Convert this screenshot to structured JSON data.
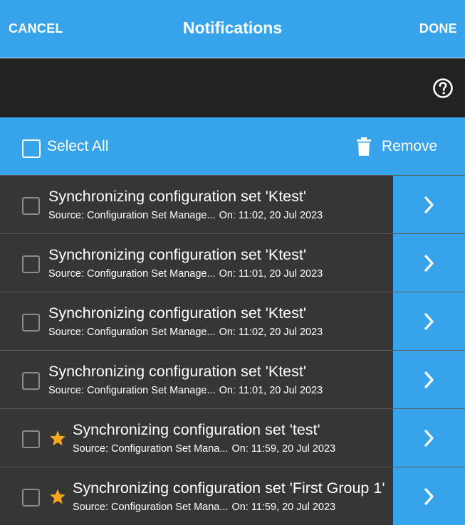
{
  "header": {
    "cancel": "CANCEL",
    "title": "Notifications",
    "done": "DONE"
  },
  "toolbar": {
    "help_icon": "help-circle-icon"
  },
  "actions": {
    "select_all": "Select All",
    "remove": "Remove",
    "remove_icon": "trash-icon"
  },
  "colors": {
    "accent": "#37a3eb",
    "star": "#f5a623",
    "row_bg": "#363636",
    "toolbar_bg": "#222222"
  },
  "notifications": [
    {
      "starred": false,
      "title": "Synchronizing configuration set 'Ktest'",
      "source": "Source: Configuration Set Manage...",
      "on": "On: 11:02, 20 Jul 2023"
    },
    {
      "starred": false,
      "title": "Synchronizing configuration set 'Ktest'",
      "source": "Source: Configuration Set Manage...",
      "on": "On: 11:01, 20 Jul 2023"
    },
    {
      "starred": false,
      "title": "Synchronizing configuration set 'Ktest'",
      "source": "Source: Configuration Set Manage...",
      "on": "On: 11:02, 20 Jul 2023"
    },
    {
      "starred": false,
      "title": "Synchronizing configuration set 'Ktest'",
      "source": "Source: Configuration Set Manage...",
      "on": "On: 11:01, 20 Jul 2023"
    },
    {
      "starred": true,
      "title": "Synchronizing configuration set 'test'",
      "source": "Source: Configuration Set Mana...",
      "on": "On: 11:59, 20 Jul 2023"
    },
    {
      "starred": true,
      "title": "Synchronizing configuration set 'First Group 1'",
      "source": "Source: Configuration Set Mana...",
      "on": "On: 11:59, 20 Jul 2023"
    }
  ]
}
